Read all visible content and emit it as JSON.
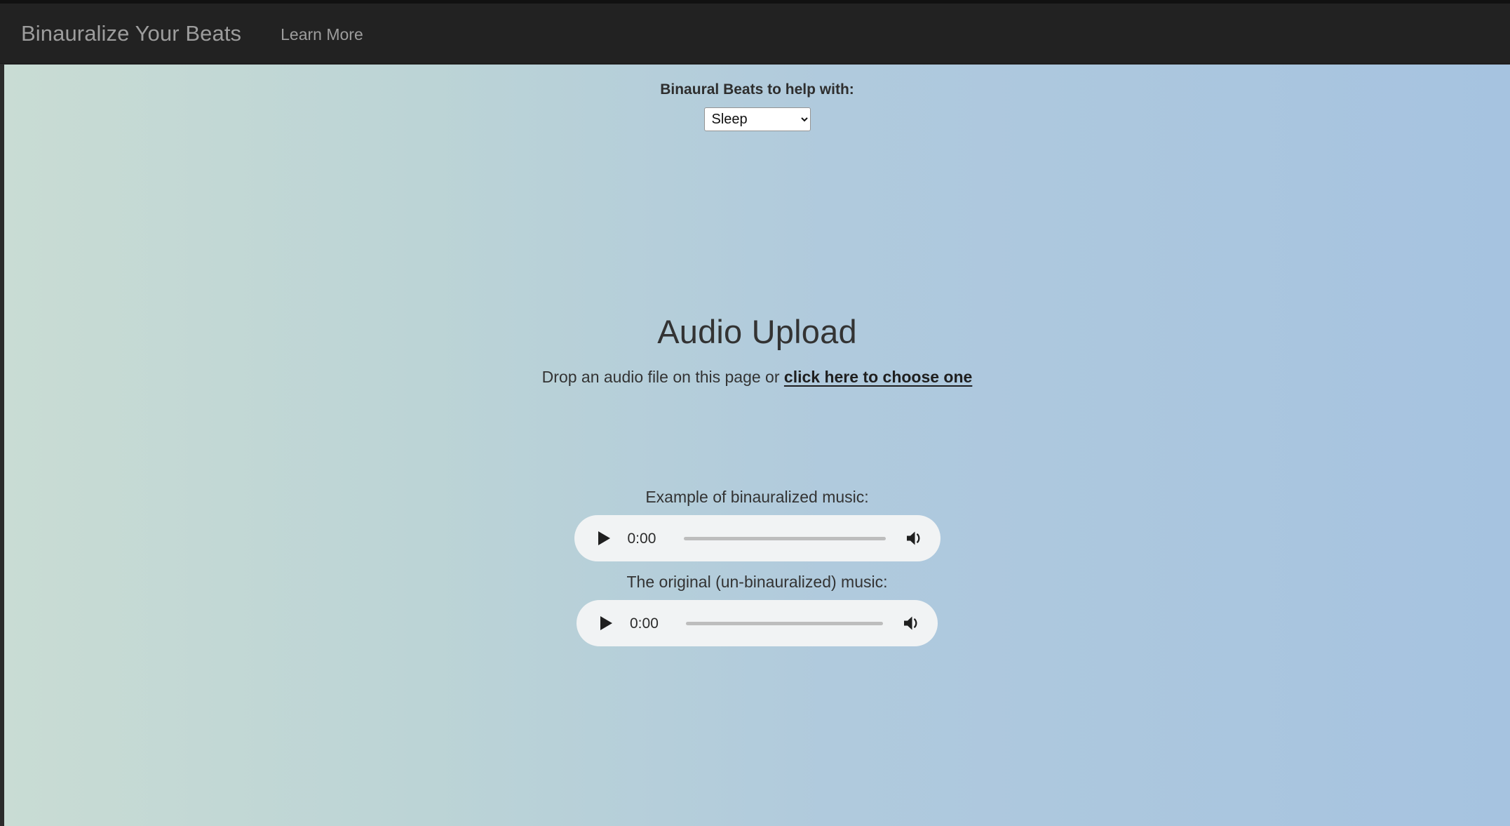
{
  "navbar": {
    "brand": "Binauralize Your Beats",
    "learn_more": "Learn More",
    "background_color": "#222222",
    "text_color": "#9d9d9d"
  },
  "selector": {
    "label": "Binaural Beats to help with:",
    "selected_value": "Sleep",
    "options": [
      "Sleep"
    ],
    "dropdown_icon": "chevron-down-icon"
  },
  "upload": {
    "heading": "Audio Upload",
    "subtext_prefix": "Drop an audio file on this page or ",
    "choose_link": "click here to choose one"
  },
  "examples": {
    "binauralized_label": "Example of binauralized music:",
    "original_label": "The original (un-binauralized) music:",
    "players": [
      {
        "time": "0:00",
        "progress_percent": 0,
        "play_icon": "play-icon",
        "volume_icon": "volume-high-icon"
      },
      {
        "time": "0:00",
        "progress_percent": 0,
        "play_icon": "play-icon",
        "volume_icon": "volume-high-icon"
      }
    ]
  },
  "theme": {
    "gradient_start": "#c9dcd4",
    "gradient_end": "#a6c3e0",
    "player_background": "#f1f3f4",
    "text_color": "#333333"
  }
}
